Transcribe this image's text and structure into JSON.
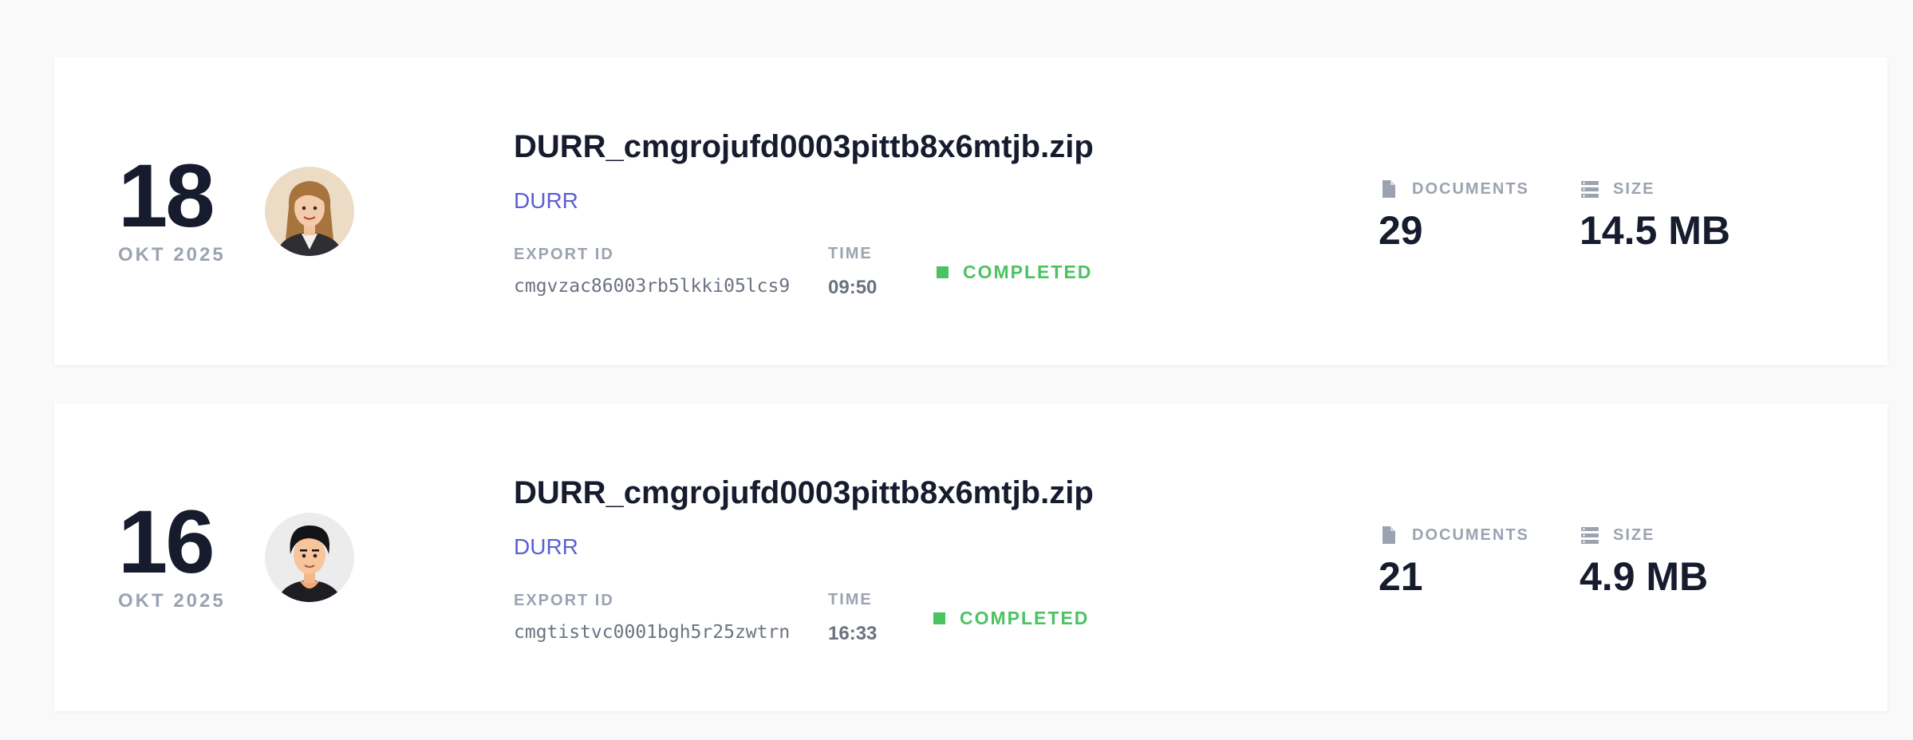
{
  "exports": [
    {
      "day": "18",
      "month_year": "OKT 2025",
      "file_name": "DURR_cmgrojufd0003pittb8x6mtjb.zip",
      "org": "DURR",
      "export_id_label": "EXPORT ID",
      "export_id": "cmgvzac86003rb5lkki05lcs9",
      "time_label": "TIME",
      "time": "09:50",
      "status": "COMPLETED",
      "documents_label": "DOCUMENTS",
      "documents": "29",
      "size_label": "SIZE",
      "size": "14.5 MB",
      "avatar": "woman-avatar"
    },
    {
      "day": "16",
      "month_year": "OKT 2025",
      "file_name": "DURR_cmgrojufd0003pittb8x6mtjb.zip",
      "org": "DURR",
      "export_id_label": "EXPORT ID",
      "export_id": "cmgtistvc0001bgh5r25zwtrn",
      "time_label": "TIME",
      "time": "16:33",
      "status": "COMPLETED",
      "documents_label": "DOCUMENTS",
      "documents": "21",
      "size_label": "SIZE",
      "size": "4.9 MB",
      "avatar": "man-avatar"
    }
  ],
  "colors": {
    "background": "#f9f9f9",
    "card": "#ffffff",
    "dark_text": "#161b2e",
    "muted_text": "#9ba3b1",
    "accent": "#5b5fd6",
    "status_completed": "#4cc263"
  }
}
